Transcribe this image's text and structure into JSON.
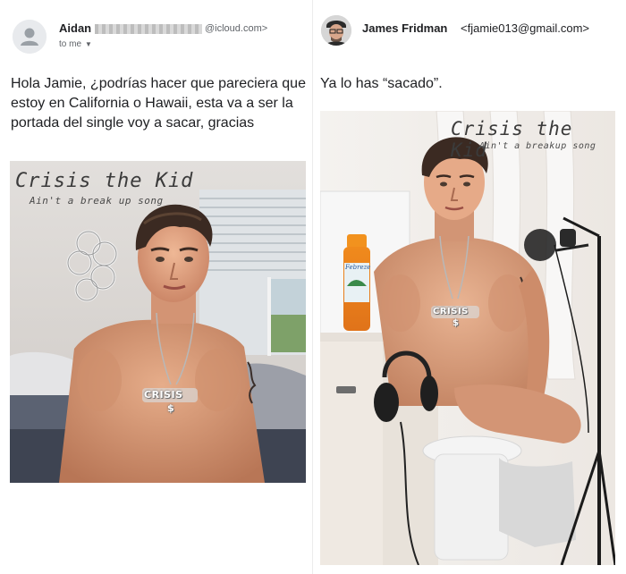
{
  "left_email": {
    "sender_name": "Aidan",
    "sender_domain": "@icloud.com>",
    "to_label": "to me",
    "message": "Hola Jamie, ¿podrías hacer que pareciera que estoy en California o Hawaii, esta va a ser la portada del single voy a sacar, gracias",
    "photo": {
      "cover_title": "Crisis the Kid",
      "cover_subtitle": "Ain't a break up song",
      "pendant_text": "CRISIS",
      "pendant_symbol": "$"
    }
  },
  "right_email": {
    "sender_name": "James Fridman",
    "sender_email": "<fjamie013@gmail.com>",
    "message": "Ya lo has “sacado”.",
    "photo": {
      "cover_title": "Crisis the Kid",
      "cover_subtitle": "Ain't a breakup song",
      "pendant_text": "CRISIS",
      "pendant_symbol": "$",
      "bottle_label": "Febreze"
    }
  },
  "colors": {
    "text": "#202124",
    "secondary_text": "#5f6368",
    "avatar_bg": "#e8eaed"
  },
  "icons": [
    "person-avatar-icon",
    "profile-photo",
    "dropdown-caret-icon"
  ]
}
